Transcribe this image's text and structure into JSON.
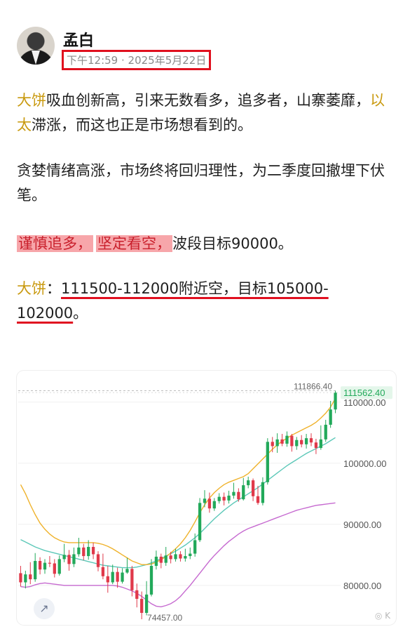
{
  "author": {
    "name": "孟白",
    "timestamp": "下午12:59 · 2025年5月22日"
  },
  "post": {
    "p1_tag1": "大饼",
    "p1_text1": "吸血创新高，引来无数看多，追多者，山寨萎靡，",
    "p1_tag2": "以太",
    "p1_text2": "滞涨，而这也正是市场想看到的。",
    "p2": "贪婪情绪高涨，市场终将回归理性，为二季度回撤埋下伏笔。",
    "p3_hl1": "谨慎追多，",
    "p3_hl2": "坚定看空，",
    "p3_text": "波段目标90000。",
    "p4_tag": "大饼",
    "p4_colon": "：",
    "p4_underlined": "111500-112000附近空，目标105000-102000",
    "p4_end": "。"
  },
  "chart_data": {
    "type": "candlestick",
    "price_axis": [
      "110000.00",
      "100000.00",
      "90000.00",
      "80000.00"
    ],
    "current_price": "111562.40",
    "high_label": "111866.40",
    "low_label": "74457.00",
    "colors": {
      "up": "#22a95a",
      "down": "#e0394a",
      "ma_fast": "#efb22b",
      "ma_mid": "#5cc8b8",
      "ma_slow": "#c66ad0",
      "current_tag_bg": "#e4f6ea"
    },
    "candles": [
      [
        82000,
        80500,
        83200,
        79800
      ],
      [
        80500,
        81800,
        82400,
        79500
      ],
      [
        81800,
        81000,
        83800,
        80200
      ],
      [
        81000,
        84000,
        85300,
        80600
      ],
      [
        84000,
        82600,
        84600,
        81800
      ],
      [
        82600,
        83700,
        84300,
        81900
      ],
      [
        83700,
        83600,
        84800,
        83000
      ],
      [
        83600,
        81900,
        84300,
        81300
      ],
      [
        81900,
        84300,
        84900,
        81600
      ],
      [
        84300,
        85000,
        86800,
        83800
      ],
      [
        85000,
        83500,
        85800,
        82400
      ],
      [
        83500,
        85100,
        86200,
        83000
      ],
      [
        85100,
        86200,
        87800,
        84700
      ],
      [
        86200,
        84800,
        86800,
        84100
      ],
      [
        84800,
        86300,
        87400,
        84200
      ],
      [
        86300,
        85100,
        87000,
        84300
      ],
      [
        85100,
        83000,
        85600,
        82300
      ],
      [
        83000,
        81500,
        85200,
        81000
      ],
      [
        81500,
        80500,
        83200,
        78800
      ],
      [
        80500,
        82200,
        83400,
        80200
      ],
      [
        82200,
        80600,
        82900,
        79600
      ],
      [
        80600,
        82100,
        82800,
        80300
      ],
      [
        82100,
        82700,
        84500,
        81900
      ],
      [
        82700,
        79200,
        83200,
        78200
      ],
      [
        79200,
        77800,
        80300,
        76400
      ],
      [
        77800,
        75500,
        79000,
        74457
      ],
      [
        75500,
        78500,
        80700,
        75100
      ],
      [
        78500,
        83200,
        84300,
        78200
      ],
      [
        83200,
        84700,
        85700,
        82600
      ],
      [
        84700,
        83700,
        85200,
        82800
      ],
      [
        83700,
        84900,
        86300,
        83200
      ],
      [
        84900,
        84300,
        85500,
        83600
      ],
      [
        84300,
        85100,
        86000,
        83900
      ],
      [
        85100,
        84400,
        85600,
        83900
      ],
      [
        84400,
        84800,
        86000,
        83900
      ],
      [
        84800,
        85200,
        86200,
        84300
      ],
      [
        85200,
        87400,
        88500,
        84700
      ],
      [
        87400,
        93500,
        94300,
        87100
      ],
      [
        93500,
        94200,
        95600,
        92800
      ],
      [
        94200,
        92600,
        95200,
        91900
      ],
      [
        92600,
        93800,
        94300,
        92200
      ],
      [
        93800,
        94500,
        95100,
        93400
      ],
      [
        94500,
        93900,
        95200,
        93100
      ],
      [
        93900,
        94700,
        95500,
        93400
      ],
      [
        94700,
        95300,
        96800,
        94200
      ],
      [
        95300,
        94100,
        95900,
        93700
      ],
      [
        94100,
        96400,
        97600,
        93900
      ],
      [
        96400,
        97200,
        97800,
        95900
      ],
      [
        97200,
        94600,
        97500,
        93800
      ],
      [
        94600,
        93500,
        96300,
        93200
      ],
      [
        93500,
        96900,
        97700,
        93100
      ],
      [
        96900,
        103500,
        104100,
        96500
      ],
      [
        103500,
        102800,
        104300,
        101800
      ],
      [
        102800,
        103900,
        104900,
        101700
      ],
      [
        103900,
        103200,
        104800,
        102800
      ],
      [
        103200,
        104500,
        105200,
        102700
      ],
      [
        104500,
        102800,
        104800,
        101900
      ],
      [
        102800,
        103800,
        104300,
        102200
      ],
      [
        103800,
        103100,
        104600,
        102600
      ],
      [
        103100,
        104100,
        104800,
        102400
      ],
      [
        104100,
        103400,
        104900,
        102800
      ],
      [
        103400,
        102500,
        104000,
        101500
      ],
      [
        102500,
        103900,
        106200,
        102200
      ],
      [
        103900,
        106300,
        107100,
        103500
      ],
      [
        106300,
        108800,
        110200,
        105800
      ],
      [
        108800,
        111562,
        111866,
        108200
      ]
    ],
    "ma_fast": [
      96500,
      95000,
      93200,
      91600,
      90200,
      89200,
      88400,
      87800,
      87400,
      87100,
      87000,
      87000,
      87000,
      87000,
      87000,
      87000,
      86900,
      86700,
      86400,
      86000,
      85500,
      85000,
      84500,
      84000,
      83700,
      83400,
      83400,
      83500,
      83800,
      84200,
      84700,
      85300,
      86000,
      86800,
      87800,
      89000,
      90400,
      91900,
      93200,
      94300,
      95200,
      95900,
      96500,
      96900,
      97200,
      97500,
      97800,
      98300,
      99100,
      99900,
      100700,
      101500,
      102300,
      103000,
      103600,
      104100,
      104600,
      105000,
      105400,
      105800,
      106200,
      106700,
      107400,
      108200,
      109200,
      110600
    ],
    "ma_mid": [
      87500,
      87100,
      86700,
      86300,
      86000,
      85700,
      85500,
      85300,
      85100,
      84900,
      84700,
      84500,
      84300,
      84100,
      83900,
      83700,
      83500,
      83300,
      83200,
      83100,
      83000,
      82900,
      82900,
      82900,
      83000,
      83200,
      83400,
      83700,
      84000,
      84400,
      84800,
      85200,
      85600,
      86100,
      86600,
      87200,
      87800,
      88500,
      89300,
      90100,
      90900,
      91600,
      92300,
      92900,
      93500,
      94000,
      94500,
      95000,
      95500,
      96000,
      96600,
      97200,
      97800,
      98400,
      99000,
      99600,
      100100,
      100600,
      101100,
      101600,
      102000,
      102400,
      102800,
      103200,
      103700,
      104200
    ],
    "ma_slow": [
      79800,
      79700,
      79800,
      80100,
      80300,
      80400,
      80300,
      80200,
      80100,
      80000,
      80000,
      80000,
      80000,
      80000,
      80000,
      80000,
      80000,
      80000,
      80000,
      80000,
      79900,
      79700,
      79400,
      79100,
      78700,
      78200,
      77600,
      77000,
      76600,
      76500,
      76700,
      77000,
      77500,
      78200,
      79100,
      80000,
      81000,
      82000,
      83000,
      84000,
      84900,
      85700,
      86500,
      87200,
      87800,
      88400,
      88900,
      89300,
      89600,
      89900,
      90200,
      90500,
      90800,
      91100,
      91400,
      91700,
      92000,
      92300,
      92500,
      92700,
      92900,
      93100,
      93200,
      93300,
      93400,
      93500
    ],
    "ylim": [
      74000,
      114000
    ]
  }
}
